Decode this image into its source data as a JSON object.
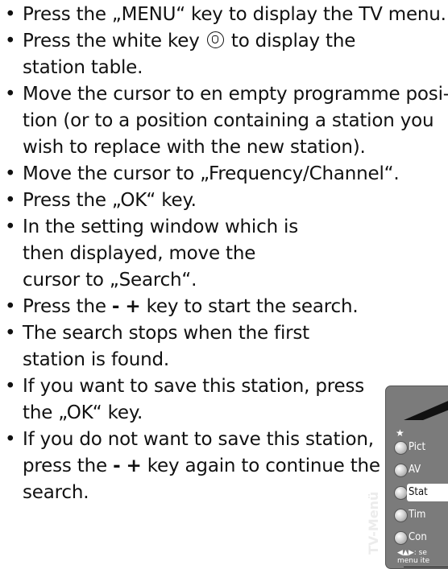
{
  "bullets": [
    {
      "text": "Press the „MENU“ key to display the TV menu."
    },
    {
      "text_before": "Press the white key",
      "icon": "station-table-key-icon",
      "text_after": "to display the station table."
    },
    {
      "text": "Move the cursor to en empty programme posi- tion (or to a position containing a station you wish to replace with the new station)."
    },
    {
      "text": "Move the cursor to „Frequency/Channel“."
    },
    {
      "text": "Press the „OK“ key."
    },
    {
      "text": "In the setting window which is then displayed, move the cursor to „Search“."
    },
    {
      "text_before": "Press the",
      "key_minus": "-",
      "key_plus": "+",
      "text_after": "key to start the search."
    },
    {
      "text": "The search stops when the first station is found."
    },
    {
      "text": "If you want to save this station, press the „OK“ key."
    },
    {
      "text_before": "If you do not want to save this station, press the",
      "key_minus": "-",
      "key_plus": "+",
      "text_after": "key again to continue the search."
    }
  ],
  "tv_menu": {
    "star": "★",
    "items": [
      {
        "label": "Pict"
      },
      {
        "label": "AV"
      },
      {
        "label": "Stat"
      },
      {
        "label": "Tim"
      },
      {
        "label": "Con"
      }
    ],
    "selected_index": 2,
    "vertical_title": "TV-Menü",
    "hint_line1": "◀▲▶: se",
    "hint_line2": "menu ite"
  }
}
